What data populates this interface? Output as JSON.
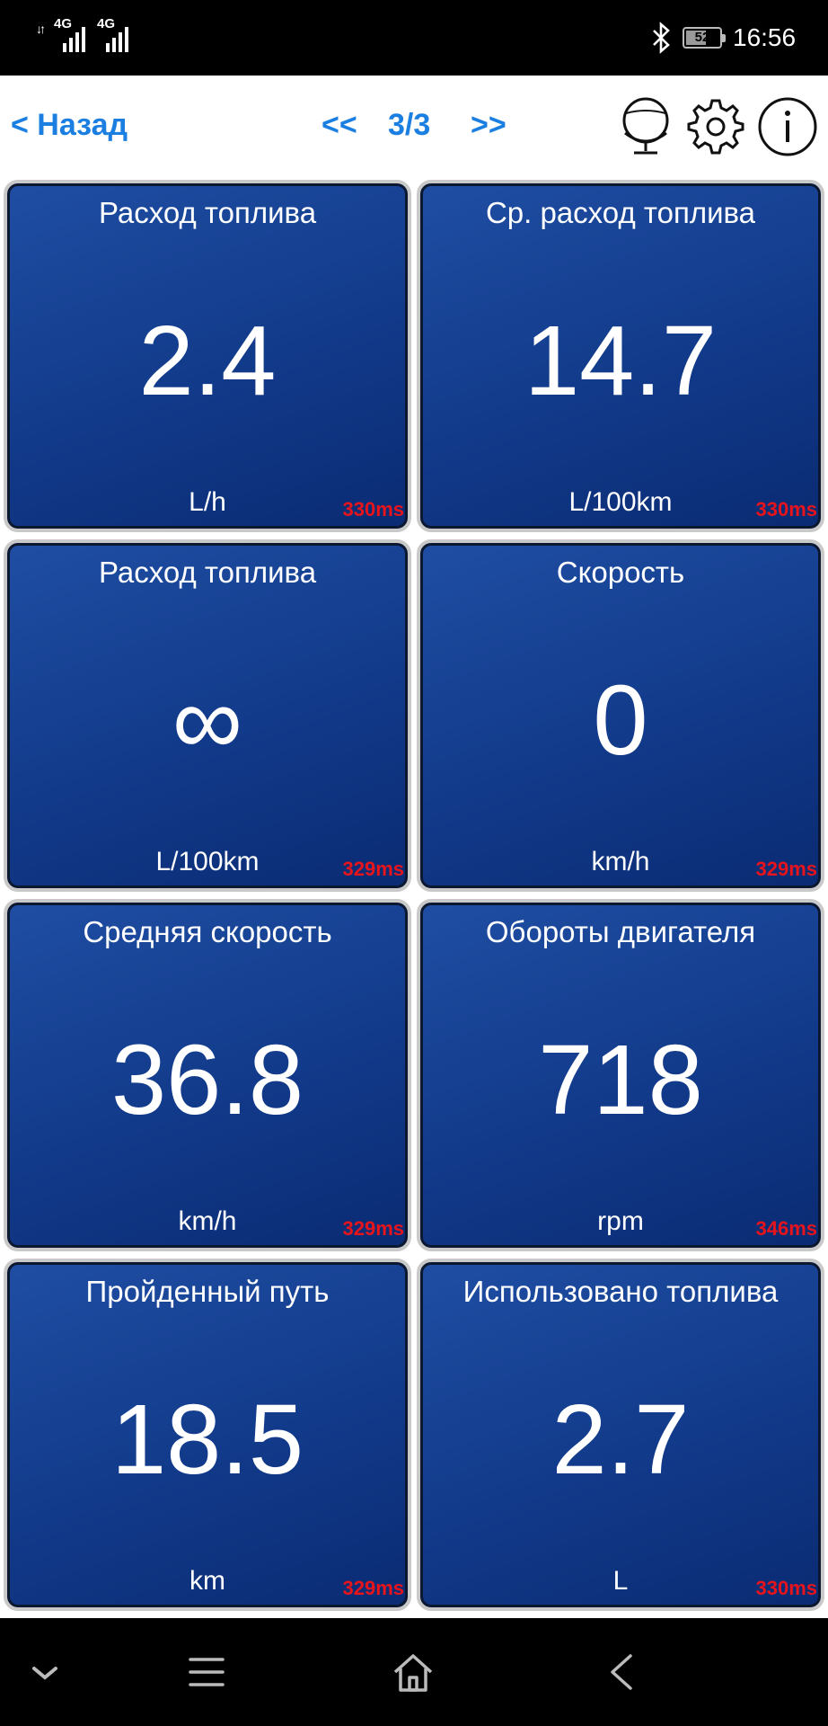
{
  "status_bar": {
    "network_1": "4G",
    "network_2": "4G",
    "battery_level": "52",
    "time": "16:56"
  },
  "header": {
    "back_label": "< Назад",
    "prev_label": "<<",
    "page_label": "3/3",
    "next_label": ">>",
    "icons": [
      "globe-icon",
      "gear-icon",
      "info-icon"
    ],
    "accent_color": "#1a7fe0"
  },
  "tiles": [
    {
      "title": "Расход топлива",
      "value": "2.4",
      "unit": "L/h",
      "latency": "330ms"
    },
    {
      "title": "Ср. расход топлива",
      "value": "14.7",
      "unit": "L/100km",
      "latency": "330ms"
    },
    {
      "title": "Расход топлива",
      "value": "∞",
      "unit": "L/100km",
      "latency": "329ms"
    },
    {
      "title": "Скорость",
      "value": "0",
      "unit": "km/h",
      "latency": "329ms"
    },
    {
      "title": "Средняя скорость",
      "value": "36.8",
      "unit": "km/h",
      "latency": "329ms"
    },
    {
      "title": "Обороты двигателя",
      "value": "718",
      "unit": "rpm",
      "latency": "346ms"
    },
    {
      "title": "Пройденный путь",
      "value": "18.5",
      "unit": "km",
      "latency": "329ms"
    },
    {
      "title": "Использовано топлива",
      "value": "2.7",
      "unit": "L",
      "latency": "330ms"
    }
  ],
  "colors": {
    "tile_bg": "#123a8a",
    "latency_red": "#e8141c"
  },
  "nav_bar": {
    "icons": [
      "chevron-down-icon",
      "menu-icon",
      "home-icon",
      "back-icon"
    ]
  }
}
